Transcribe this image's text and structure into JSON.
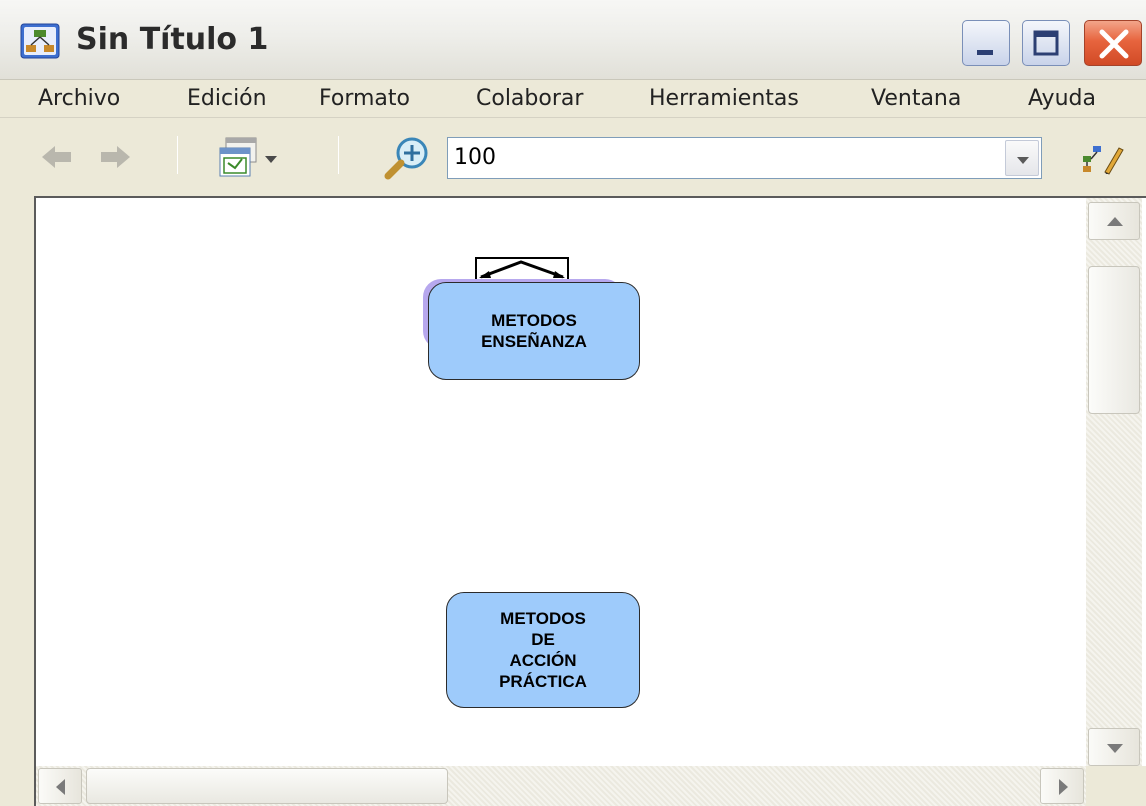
{
  "window": {
    "title": "Sin Título 1",
    "icons": {
      "app": "concept-map-app-icon",
      "minimize": "minimize-icon",
      "maximize": "maximize-icon",
      "close": "close-icon"
    }
  },
  "menu": {
    "items": [
      "Archivo",
      "Edición",
      "Formato",
      "Colaborar",
      "Herramientas",
      "Ventana",
      "Ayuda"
    ]
  },
  "toolbar": {
    "back_icon": "arrow-left-icon",
    "forward_icon": "arrow-right-icon",
    "view_icon": "window-view-icon",
    "zoom_icon": "zoom-in-icon",
    "zoom_value": "100",
    "style_icon": "style-palette-icon"
  },
  "canvas": {
    "concepts": [
      {
        "id": "metodos-ensenanza",
        "label": "METODOS\nENSEÑANZA"
      },
      {
        "id": "metodos-accion-practica",
        "label": "METODOS\nDE\nACCIÓN\nPRÁCTICA"
      }
    ]
  },
  "colors": {
    "concept_fill": "#9ecbfb",
    "concept_border": "#2b2b2b",
    "selection_glow": "#b7a8ee",
    "close_button": "#e7643e"
  }
}
